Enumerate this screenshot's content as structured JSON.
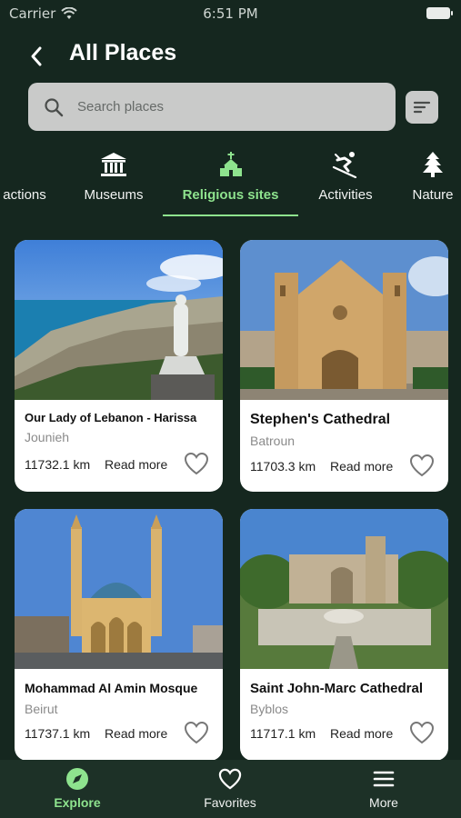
{
  "status": {
    "carrier": "Carrier",
    "time": "6:51 PM"
  },
  "header": {
    "title": "All Places"
  },
  "search": {
    "placeholder": "Search places"
  },
  "categories": [
    {
      "label": "actions",
      "icon": "star-icon"
    },
    {
      "label": "Museums",
      "icon": "museum-icon"
    },
    {
      "label": "Religious sites",
      "icon": "church-icon",
      "active": true
    },
    {
      "label": "Activities",
      "icon": "skiing-icon"
    },
    {
      "label": "Nature",
      "icon": "tree-icon"
    }
  ],
  "places": [
    {
      "name": "Our Lady of Lebanon - Harissa",
      "location": "Jounieh",
      "distance": "11732.1 km",
      "read_more": "Read more"
    },
    {
      "name": "Stephen's Cathedral",
      "location": "Batroun",
      "distance": "11703.3 km",
      "read_more": "Read more"
    },
    {
      "name": "Mohammad Al Amin Mosque",
      "location": "Beirut",
      "distance": "11737.1 km",
      "read_more": "Read more"
    },
    {
      "name": "Saint John-Marc Cathedral",
      "location": "Byblos",
      "distance": "11717.1 km",
      "read_more": "Read more"
    }
  ],
  "tabs": [
    {
      "label": "Explore",
      "icon": "compass-icon",
      "active": true
    },
    {
      "label": "Favorites",
      "icon": "heart-icon"
    },
    {
      "label": "More",
      "icon": "menu-icon"
    }
  ],
  "colors": {
    "background": "#15271f",
    "accent": "#8ee38e",
    "tabbar": "#1d3127",
    "search": "#c9cac9"
  }
}
